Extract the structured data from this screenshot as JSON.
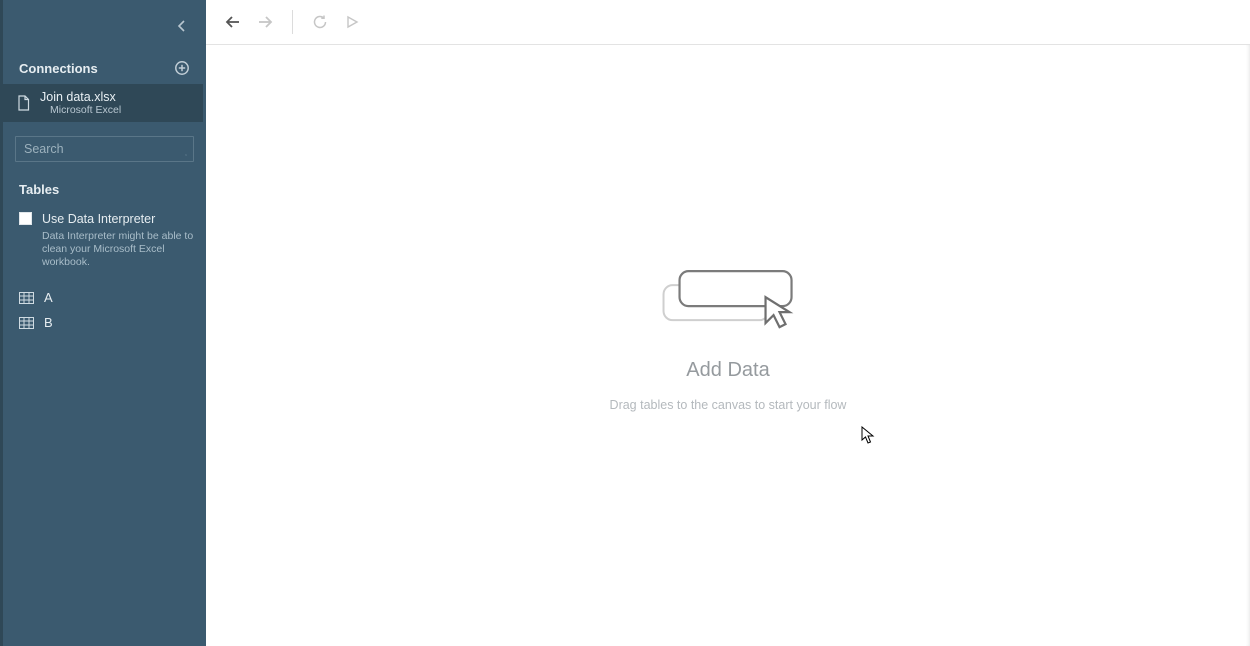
{
  "sidebar": {
    "connections_label": "Connections",
    "connection": {
      "title": "Join data.xlsx",
      "subtitle": "Microsoft Excel"
    },
    "search_placeholder": "Search",
    "tables_label": "Tables",
    "interpreter": {
      "label": "Use Data Interpreter",
      "hint": "Data Interpreter might be able to clean your Microsoft Excel workbook."
    },
    "tables": [
      {
        "name": "A"
      },
      {
        "name": "B"
      }
    ]
  },
  "canvas": {
    "title": "Add Data",
    "subtitle": "Drag tables to the canvas to start your flow"
  }
}
